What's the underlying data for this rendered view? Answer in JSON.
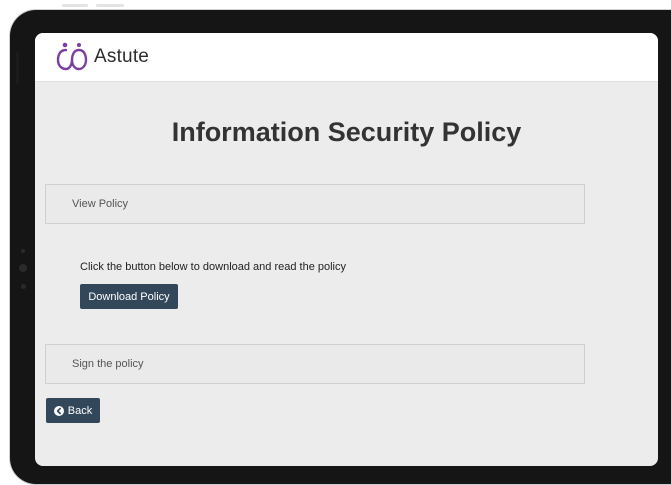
{
  "app": {
    "logo_text": "Astute",
    "brand_color": "#7b3fa0",
    "logo_icon": "astute-logo-icon"
  },
  "page": {
    "title": "Information Security Policy"
  },
  "sections": {
    "view_policy_label": "View Policy",
    "instruction_text": "Click the button below to download and read the policy",
    "download_button_label": "Download Policy",
    "sign_policy_label": "Sign the policy"
  },
  "footer": {
    "back_label": "Back",
    "back_icon": "arrow-left-circle-icon"
  },
  "colors": {
    "button_bg": "#33475b",
    "screen_bg": "#ececec",
    "accordion_bg": "#eaeaea"
  }
}
